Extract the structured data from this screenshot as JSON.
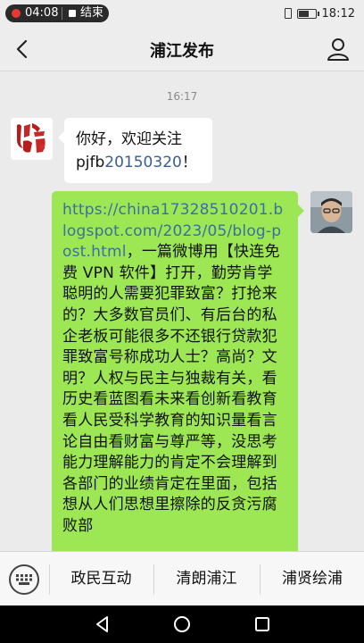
{
  "status_bar": {
    "record_time": "04:08",
    "end_label": "结束",
    "clock": "18:12",
    "icons": [
      "vibrate-icon",
      "battery-icon"
    ]
  },
  "header": {
    "title": "浦江发布",
    "back_icon": "chevron-left-icon",
    "profile_icon": "person-icon"
  },
  "chat": {
    "timestamp": "16:17",
    "messages": [
      {
        "side": "left",
        "sender_avatar": "浦江 logo",
        "text_prefix": "你好，欢迎关注pjfb",
        "text_link": "20150320",
        "text_suffix": "！"
      },
      {
        "side": "right",
        "link": "https://china17328510201.blogspot.com/2023/05/blog-post.html",
        "text": "，一篇微博用【快连免费 VPN 软件】打开，勤劳肯学聪明的人需要犯罪致富？打抢来的？大多数官员们、有后台的私企老板可能很多不还银行贷款犯罪致富号称成功人士？高尚？文明？人权与民主与独裁有关，看历史看蓝图看未来看创新看教育看人民受科学教育的知识量看言论自由看财富与尊严等，没思考能力理解能力的肯定不会理解到各部门的业绩肯定在里面，包括想从人们思想里擦除的反贪污腐败部"
      }
    ]
  },
  "bottom_menu": {
    "keyboard_icon": "keyboard-icon",
    "items": [
      "政民互动",
      "清朗浦江",
      "浦贤绘浦"
    ]
  },
  "nav_bar": {
    "icons": [
      "back-triangle-icon",
      "home-circle-icon",
      "recent-square-icon"
    ]
  },
  "colors": {
    "bubble_right": "#9de754",
    "bubble_left": "#ffffff",
    "background": "#ebebeb",
    "link": "#3a6fa3"
  }
}
